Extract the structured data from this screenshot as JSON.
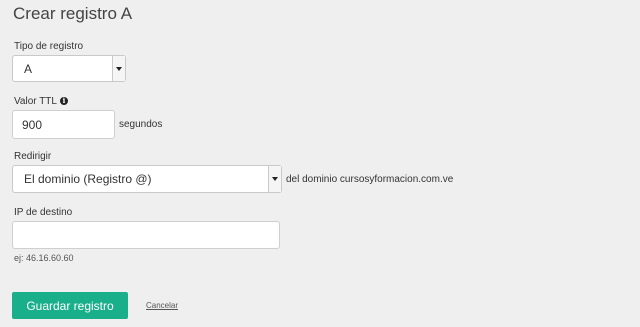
{
  "page": {
    "title": "Crear registro A"
  },
  "record_type": {
    "label": "Tipo de registro",
    "value": "A"
  },
  "ttl": {
    "label": "Valor TTL",
    "value": "900",
    "unit": "segundos",
    "info_icon": "info-icon"
  },
  "redirect": {
    "label": "Redirigir",
    "value": "El dominio (Registro @)",
    "suffix": "del dominio cursosyformacion.com.ve"
  },
  "destination_ip": {
    "label": "IP de destino",
    "value": "",
    "hint": "ej: 46.16.60.60"
  },
  "actions": {
    "save_label": "Guardar registro",
    "cancel_label": "Cancelar"
  },
  "colors": {
    "accent": "#1aaf8b",
    "background": "#efefef"
  }
}
